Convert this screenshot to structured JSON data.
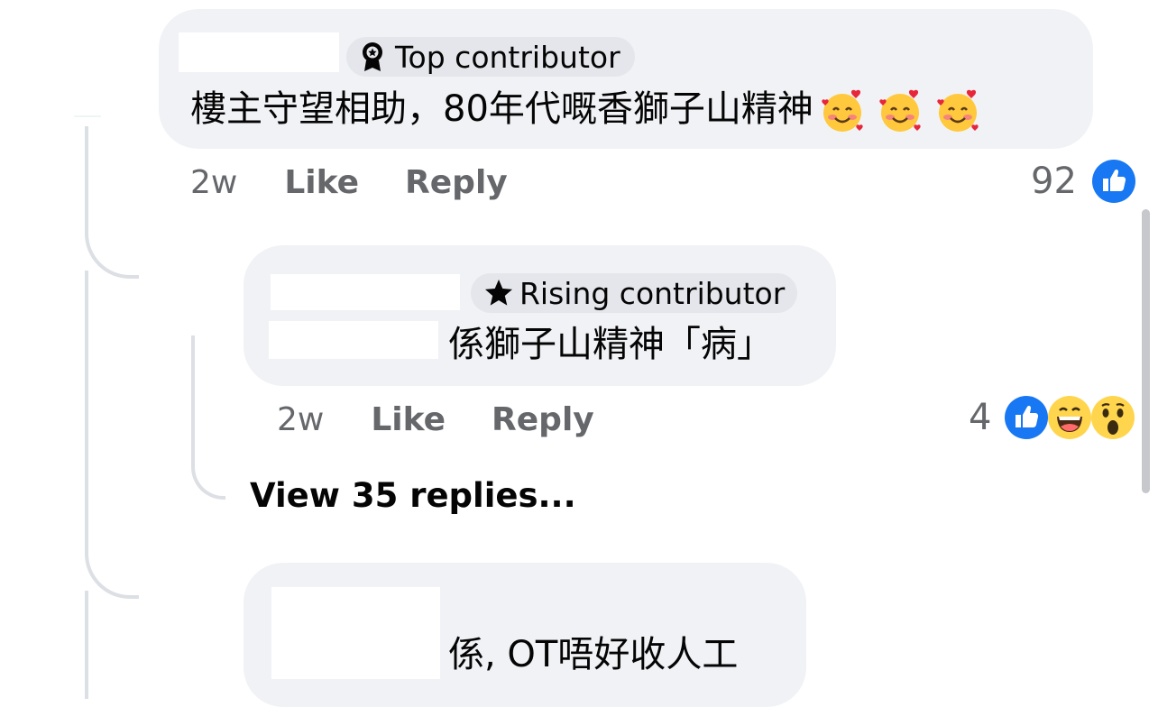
{
  "colors": {
    "bubble_bg": "#f0f2f5",
    "badge_bg": "#e4e6eb",
    "meta_text": "#65676b",
    "like_blue": "#1877f2",
    "thread_line": "#dcdfe4"
  },
  "comments": [
    {
      "badge": {
        "icon": "award-medal-icon",
        "label": "Top contributor"
      },
      "text": "樓主守望相助，80年代嘅香獅子山精神",
      "emoji": [
        "smiling-face-with-hearts",
        "smiling-face-with-hearts",
        "smiling-face-with-hearts"
      ],
      "time": "2w",
      "like_label": "Like",
      "reply_label": "Reply",
      "reaction_count": "92",
      "reactions": [
        "like"
      ]
    },
    {
      "badge": {
        "icon": "star-icon",
        "label": "Rising contributor"
      },
      "text": "係獅子山精神「病」",
      "time": "2w",
      "like_label": "Like",
      "reply_label": "Reply",
      "reaction_count": "4",
      "reactions": [
        "like",
        "haha",
        "wow"
      ],
      "view_replies_label": "View 35 replies..."
    },
    {
      "text": "係, OT唔好收人工"
    }
  ]
}
